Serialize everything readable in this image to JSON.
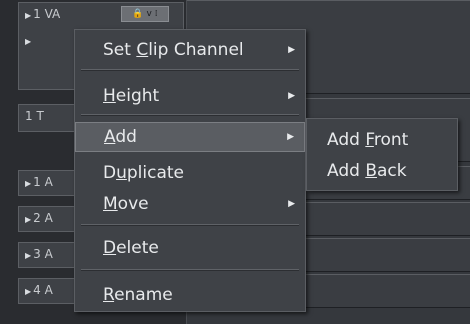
{
  "tracks": [
    {
      "name": "1 VA",
      "kind": "video-audio"
    },
    {
      "name": "1 T",
      "kind": "title"
    },
    {
      "name": "1 A",
      "kind": "audio"
    },
    {
      "name": "2 A",
      "kind": "audio"
    },
    {
      "name": "3 A",
      "kind": "audio"
    },
    {
      "name": "4 A",
      "kind": "audio"
    }
  ],
  "track_icons": {
    "lock": "🔒",
    "mode": "v",
    "bars": "⁞"
  },
  "menu": {
    "items": [
      {
        "pre": "Set ",
        "ul": "C",
        "post": "lip Channel",
        "has_submenu": true
      },
      {
        "pre": "",
        "ul": "H",
        "post": "eight",
        "has_submenu": true
      },
      {
        "pre": "",
        "ul": "A",
        "post": "dd",
        "has_submenu": true,
        "active": true
      },
      {
        "pre": "D",
        "ul": "u",
        "post": "plicate",
        "has_submenu": false
      },
      {
        "pre": "",
        "ul": "M",
        "post": "ove",
        "has_submenu": true
      },
      {
        "pre": "",
        "ul": "D",
        "post": "elete",
        "has_submenu": false
      },
      {
        "pre": "",
        "ul": "R",
        "post": "ename",
        "has_submenu": false
      }
    ]
  },
  "submenu": {
    "items": [
      {
        "pre": "Add ",
        "ul": "F",
        "post": "ront"
      },
      {
        "pre": "Add ",
        "ul": "B",
        "post": "ack"
      }
    ]
  },
  "arrow_glyph": "▶",
  "colors": {
    "menu_bg": "#3f4247",
    "highlight": "#5a5d62",
    "text": "#e8eaec"
  }
}
